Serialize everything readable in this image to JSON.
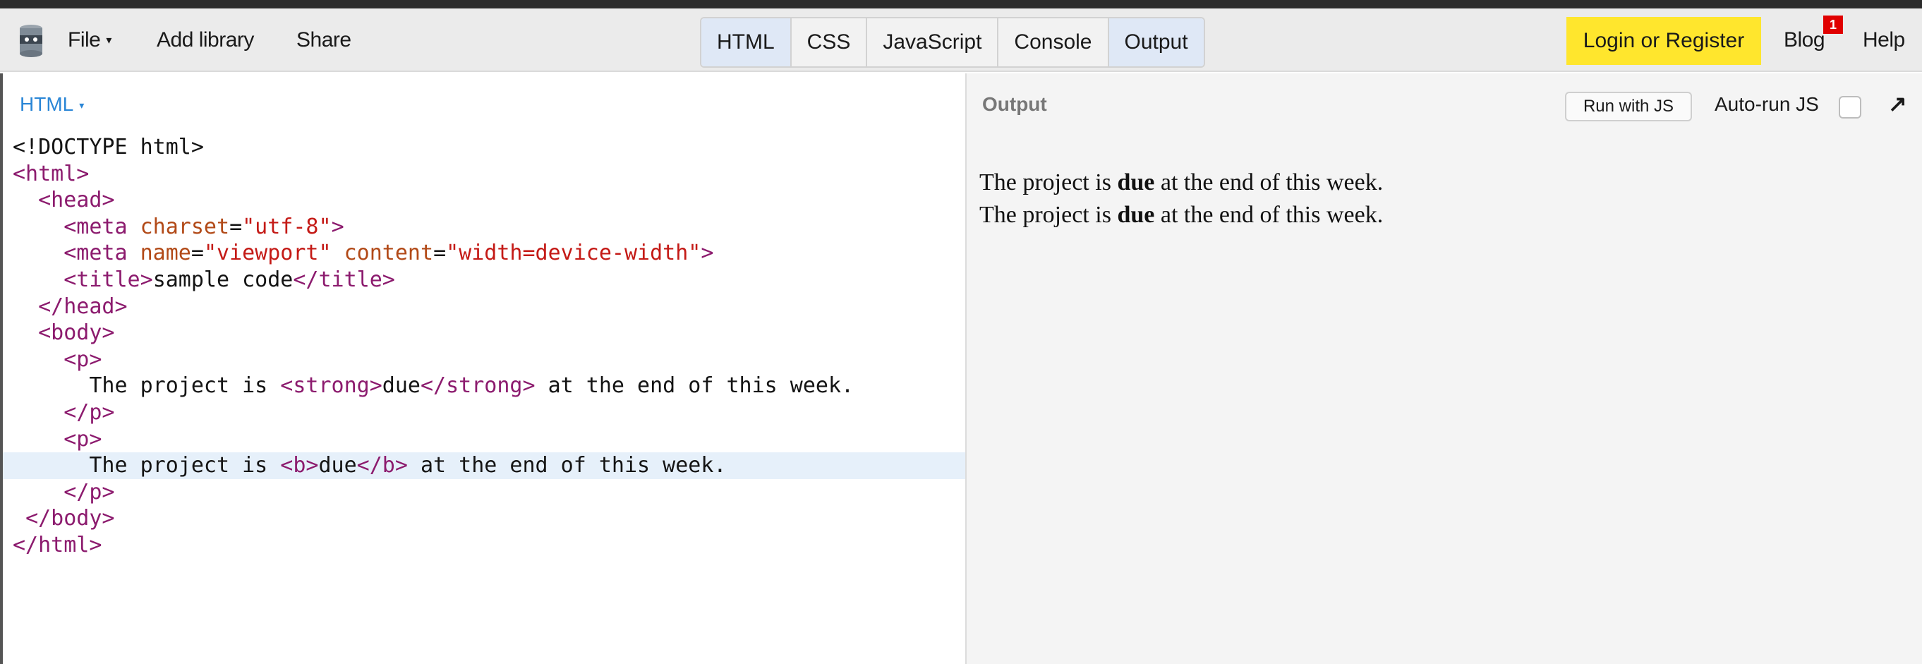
{
  "toolbar": {
    "file_label": "File",
    "add_library_label": "Add library",
    "share_label": "Share",
    "panel_toggles": [
      {
        "label": "HTML",
        "active": true
      },
      {
        "label": "CSS",
        "active": false
      },
      {
        "label": "JavaScript",
        "active": false
      },
      {
        "label": "Console",
        "active": false
      },
      {
        "label": "Output",
        "active": true
      }
    ],
    "login_label": "Login or Register",
    "blog_label": "Blog",
    "blog_badge": "1",
    "help_label": "Help"
  },
  "editor": {
    "language_label": "HTML",
    "highlighted_line": 13,
    "code_lines": [
      [
        {
          "t": "txt",
          "v": "<!DOCTYPE html>"
        }
      ],
      [
        {
          "t": "tag",
          "v": "<html>"
        }
      ],
      [
        {
          "t": "txt",
          "v": "  "
        },
        {
          "t": "tag",
          "v": "<head>"
        }
      ],
      [
        {
          "t": "txt",
          "v": "    "
        },
        {
          "t": "tag",
          "v": "<meta "
        },
        {
          "t": "attr",
          "v": "charset"
        },
        {
          "t": "txt",
          "v": "="
        },
        {
          "t": "str",
          "v": "\"utf-8\""
        },
        {
          "t": "tag",
          "v": ">"
        }
      ],
      [
        {
          "t": "txt",
          "v": "    "
        },
        {
          "t": "tag",
          "v": "<meta "
        },
        {
          "t": "attr",
          "v": "name"
        },
        {
          "t": "txt",
          "v": "="
        },
        {
          "t": "str",
          "v": "\"viewport\""
        },
        {
          "t": "txt",
          "v": " "
        },
        {
          "t": "attr",
          "v": "content"
        },
        {
          "t": "txt",
          "v": "="
        },
        {
          "t": "str",
          "v": "\"width=device-width\""
        },
        {
          "t": "tag",
          "v": ">"
        }
      ],
      [
        {
          "t": "txt",
          "v": "    "
        },
        {
          "t": "tag",
          "v": "<title>"
        },
        {
          "t": "txt",
          "v": "sample code"
        },
        {
          "t": "tag",
          "v": "</title>"
        }
      ],
      [
        {
          "t": "txt",
          "v": "  "
        },
        {
          "t": "tag",
          "v": "</head>"
        }
      ],
      [
        {
          "t": "txt",
          "v": "  "
        },
        {
          "t": "tag",
          "v": "<body>"
        }
      ],
      [
        {
          "t": "txt",
          "v": "    "
        },
        {
          "t": "tag",
          "v": "<p>"
        }
      ],
      [
        {
          "t": "txt",
          "v": "      The project is "
        },
        {
          "t": "tag",
          "v": "<strong>"
        },
        {
          "t": "txt",
          "v": "due"
        },
        {
          "t": "tag",
          "v": "</strong>"
        },
        {
          "t": "txt",
          "v": " at the end of this week."
        }
      ],
      [
        {
          "t": "txt",
          "v": "    "
        },
        {
          "t": "tag",
          "v": "</p>"
        }
      ],
      [
        {
          "t": "txt",
          "v": "    "
        },
        {
          "t": "tag",
          "v": "<p>"
        }
      ],
      [
        {
          "t": "txt",
          "v": "      The project is "
        },
        {
          "t": "tag",
          "v": "<b>"
        },
        {
          "t": "txt",
          "v": "due"
        },
        {
          "t": "tag",
          "v": "</b>"
        },
        {
          "t": "txt",
          "v": " at the end of this week."
        }
      ],
      [
        {
          "t": "txt",
          "v": "    "
        },
        {
          "t": "tag",
          "v": "</p>"
        }
      ],
      [
        {
          "t": "txt",
          "v": " "
        },
        {
          "t": "tag",
          "v": "</body>"
        }
      ],
      [
        {
          "t": "tag",
          "v": "</html>"
        }
      ]
    ]
  },
  "output": {
    "label": "Output",
    "run_label": "Run with JS",
    "autorun_label": "Auto-run JS",
    "autorun_checked": false,
    "paragraphs": [
      {
        "before": "The project is ",
        "bold": "due",
        "after": " at the end of this week."
      },
      {
        "before": "The project is ",
        "bold": "due",
        "after": " at the end of this week."
      }
    ]
  }
}
